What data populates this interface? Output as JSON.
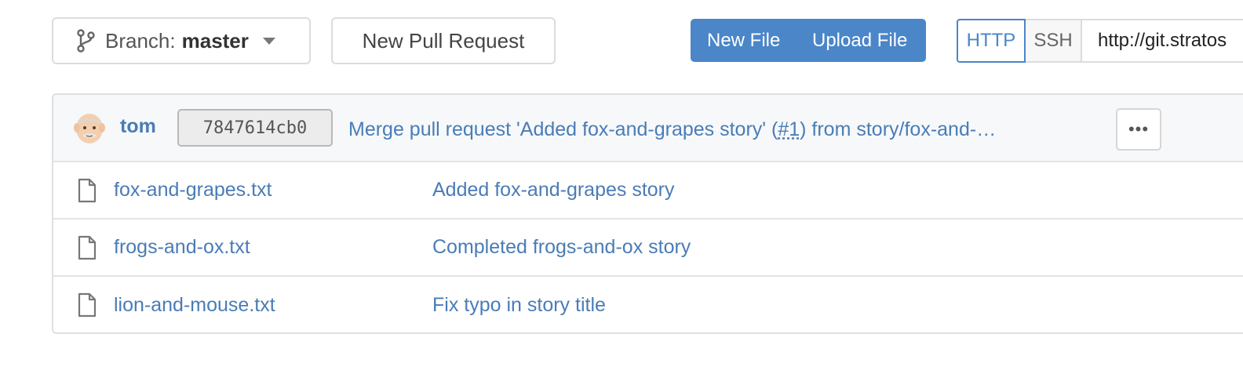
{
  "toolbar": {
    "branch_prefix": "Branch:",
    "branch_name": "master",
    "new_pull_request": "New Pull Request",
    "new_file": "New File",
    "upload_file": "Upload File",
    "clone": {
      "http": "HTTP",
      "ssh": "SSH",
      "url": "http://git.stratos"
    }
  },
  "latest_commit": {
    "author": "tom",
    "sha": "7847614cb0",
    "message_before": "Merge pull request 'Added fox-and-grapes story' (",
    "pr_ref": "#1",
    "message_after": ") from story/fox-and-…",
    "more": "•••"
  },
  "files": [
    {
      "name": "fox-and-grapes.txt",
      "commit": "Added fox-and-grapes story"
    },
    {
      "name": "frogs-and-ox.txt",
      "commit": "Completed frogs-and-ox story"
    },
    {
      "name": "lion-and-mouse.txt",
      "commit": "Fix typo in story title"
    }
  ],
  "colors": {
    "accent": "#4a86c8",
    "link": "#4a7cb6",
    "border": "#dcdcdc",
    "commit_bar_bg": "#f6f8fa"
  },
  "icons": {
    "branch": "git-branch-icon",
    "caret": "caret-down-icon",
    "file": "file-icon",
    "avatar": "user-avatar",
    "more": "ellipsis-icon"
  }
}
